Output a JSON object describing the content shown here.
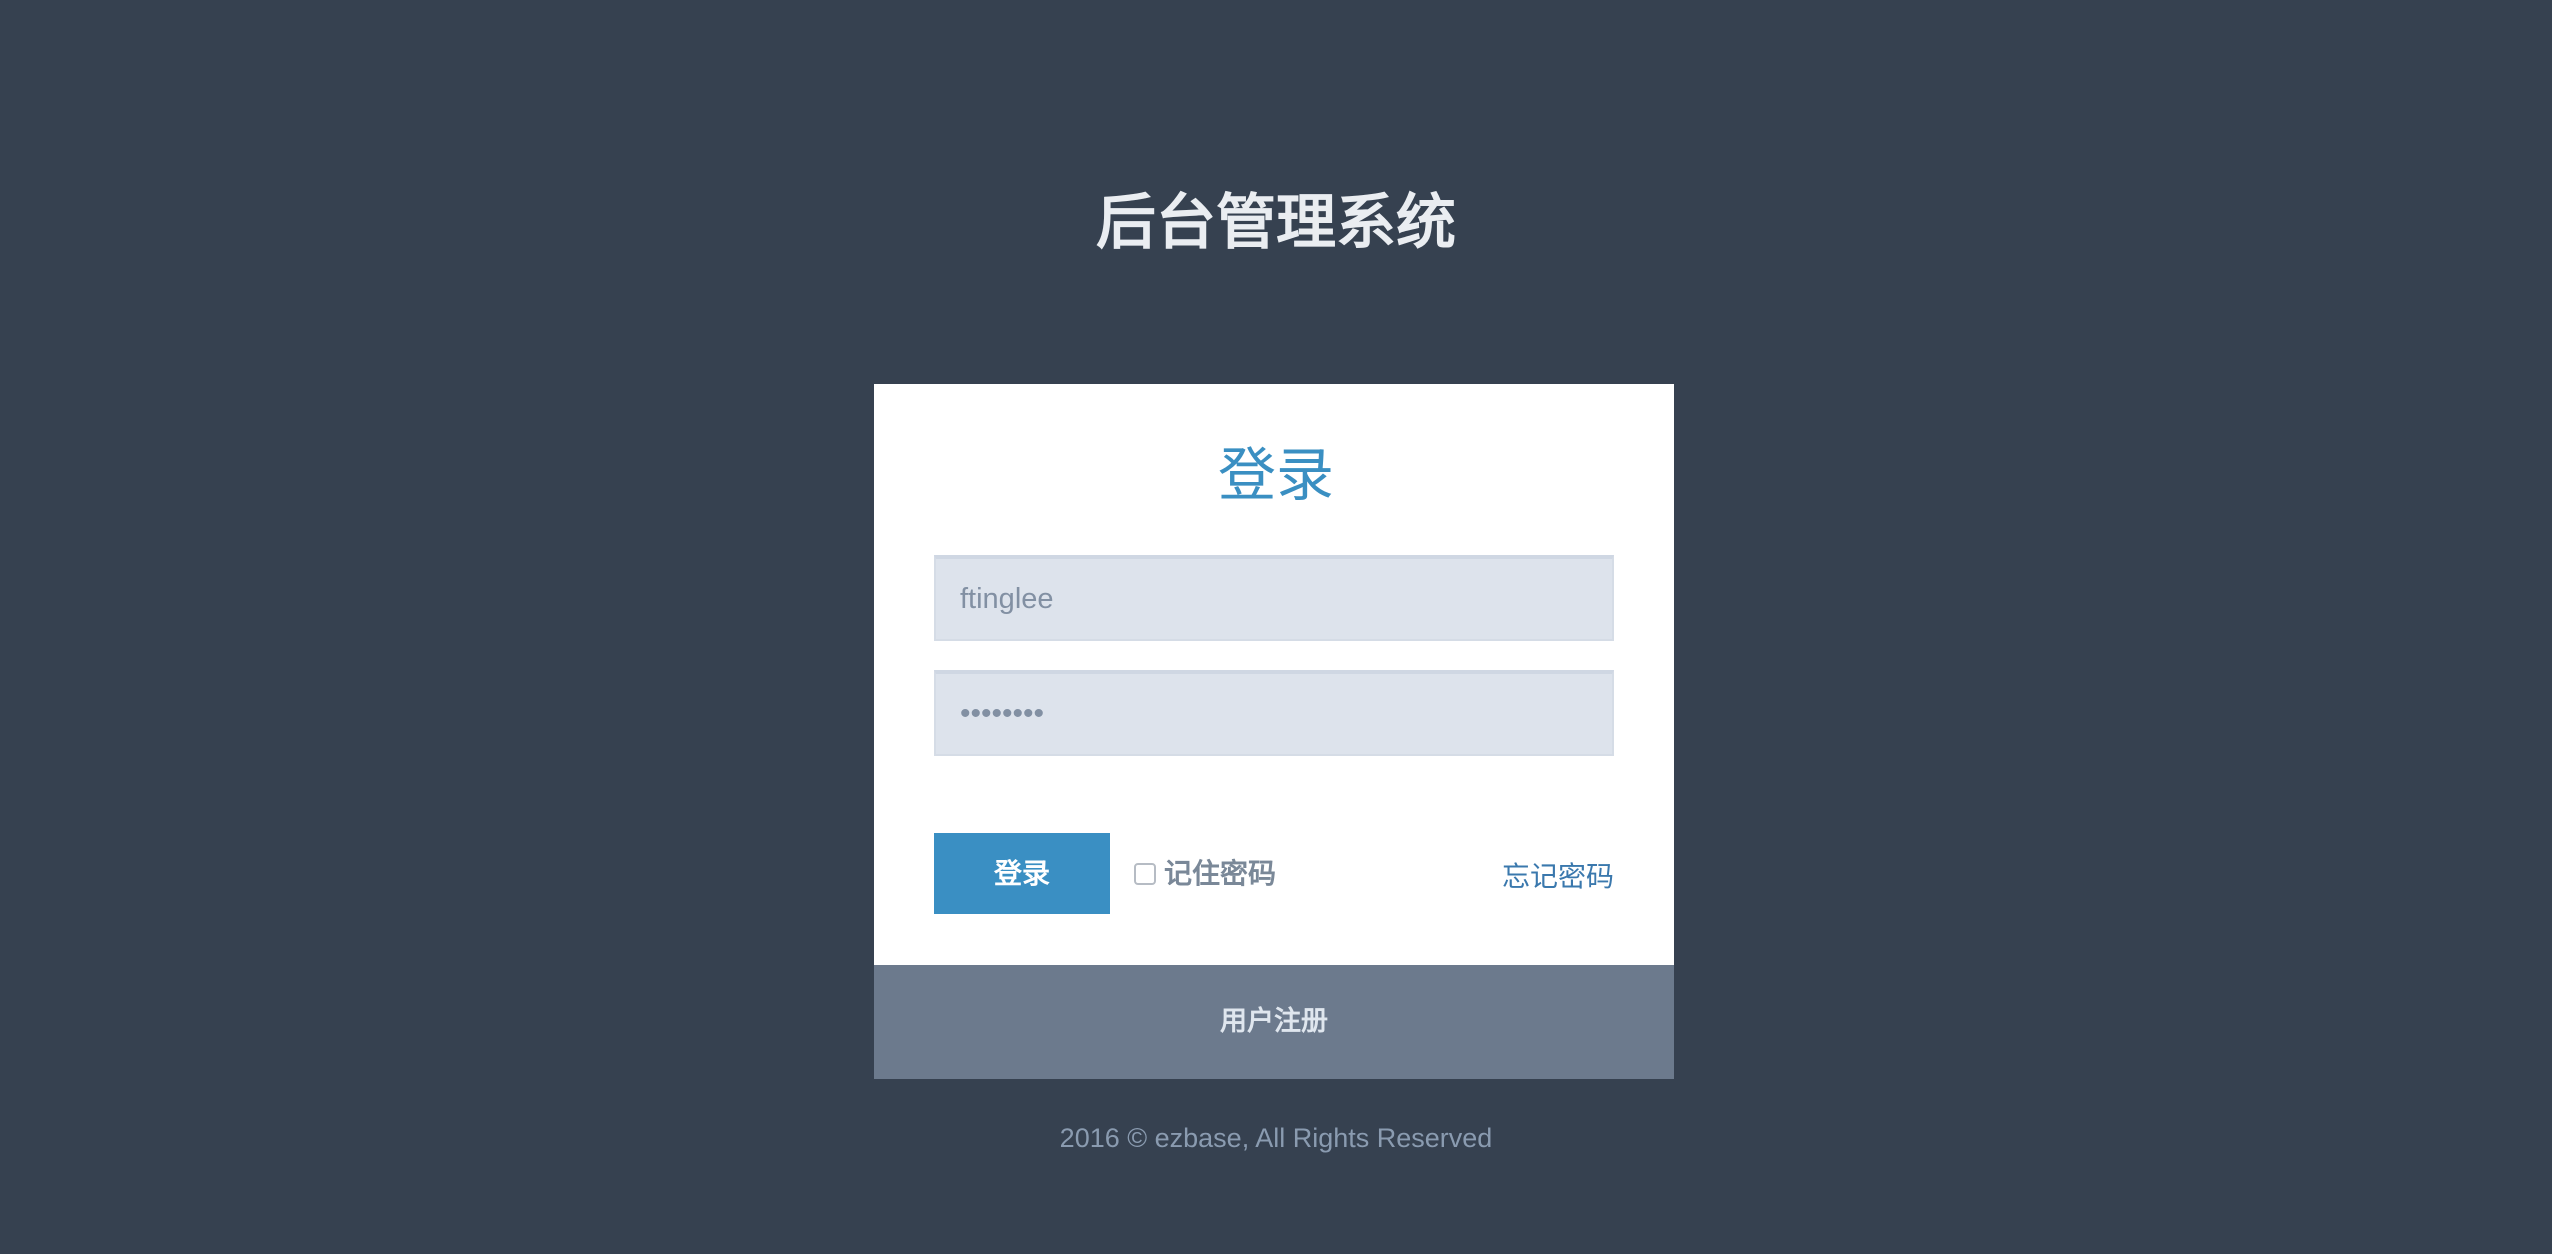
{
  "header": {
    "title": "后台管理系统"
  },
  "login_form": {
    "heading": "登录",
    "username_value": "ftinglee",
    "password_masked": "••••••••",
    "submit_label": "登录",
    "remember_label": "记住密码",
    "remember_checked": false,
    "forgot_label": "忘记密码"
  },
  "register": {
    "label": "用户注册"
  },
  "footer": {
    "copyright": "2016 © ezbase, All Rights Reserved"
  },
  "colors": {
    "background": "#364150",
    "accent": "#3a8fc3",
    "card": "#ffffff",
    "input_bg": "#dde3ec",
    "register_bar": "#6c7a8d"
  }
}
